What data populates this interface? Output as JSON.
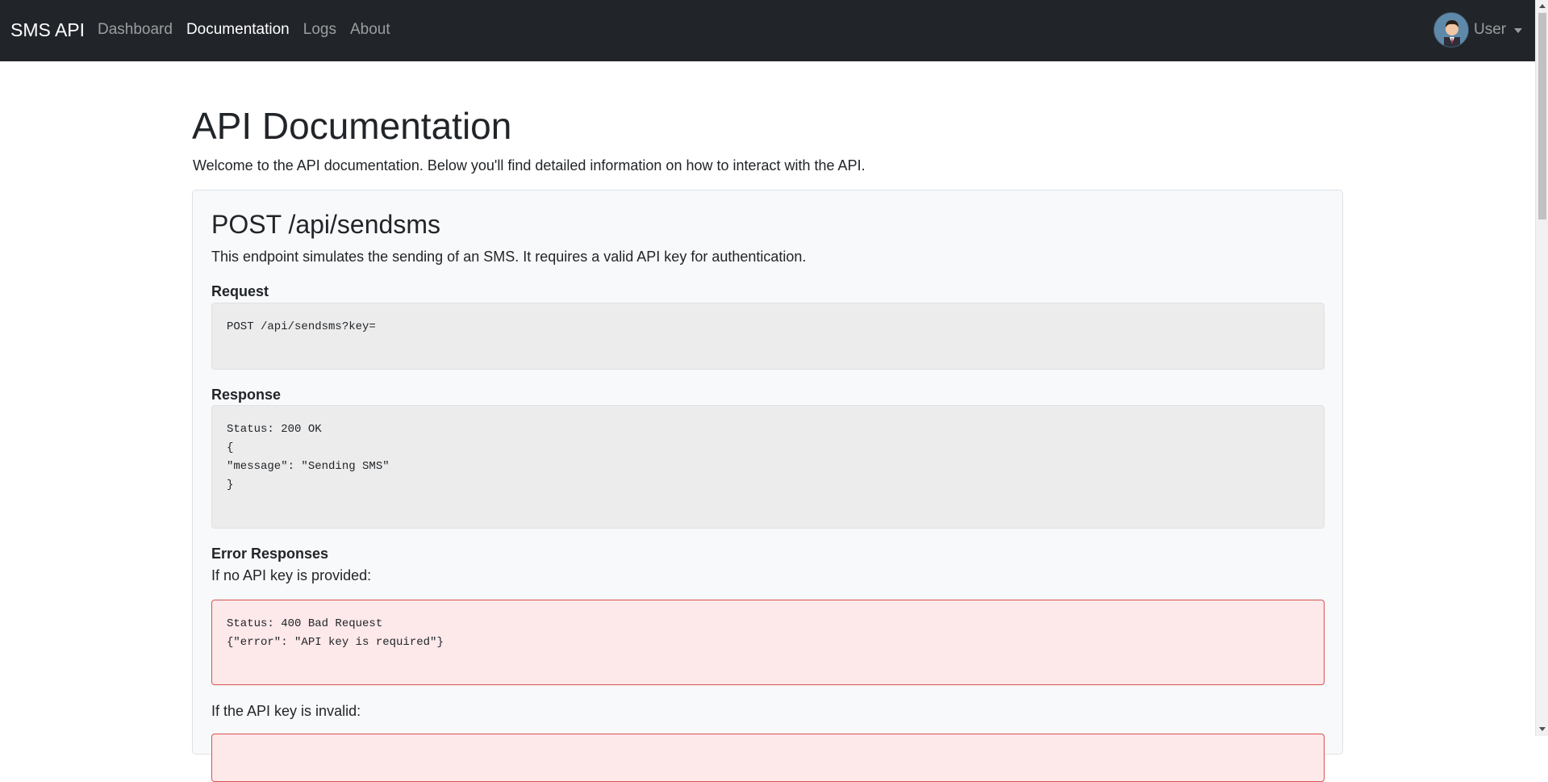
{
  "navbar": {
    "brand": "SMS API",
    "links": [
      {
        "label": "Dashboard",
        "active": false
      },
      {
        "label": "Documentation",
        "active": true
      },
      {
        "label": "Logs",
        "active": false
      },
      {
        "label": "About",
        "active": false
      }
    ],
    "user": {
      "label": "User",
      "avatar_icon": "avatar-icon"
    },
    "colors": {
      "background": "#212529",
      "active_link": "#ffffff",
      "inactive_link": "#8c8f92"
    }
  },
  "page": {
    "title": "API Documentation",
    "intro": "Welcome to the API documentation. Below you'll find detailed information on how to interact with the API."
  },
  "endpoint": {
    "title": "POST /api/sendsms",
    "description": "This endpoint simulates the sending of an SMS. It requires a valid API key for authentication.",
    "request": {
      "label": "Request",
      "code": "POST /api/sendsms?key="
    },
    "response": {
      "label": "Response",
      "code": "Status: 200 OK\n{\n\"message\": \"Sending SMS\"\n}"
    },
    "errors": {
      "label": "Error Responses",
      "no_key_text": "If no API key is provided:",
      "no_key_code": "Status: 400 Bad Request\n{\"error\": \"API key is required\"}",
      "invalid_key_text": "If the API key is invalid:"
    },
    "colors": {
      "error_bg": "#fde8ea",
      "error_border": "#d9534f",
      "code_bg": "#ececec"
    }
  }
}
